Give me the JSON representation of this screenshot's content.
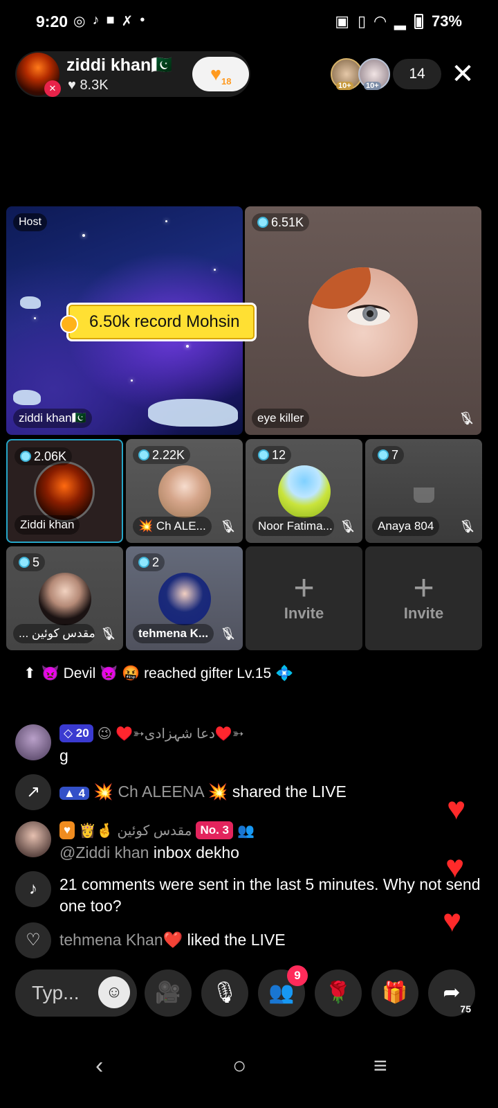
{
  "status": {
    "time": "9:20",
    "battery": "73%"
  },
  "host": {
    "name": "ziddi khan🇵🇰",
    "likes": "8.3K",
    "follow_count": "18"
  },
  "viewers": {
    "badge1": "10+",
    "badge2": "10+",
    "count": "14"
  },
  "stage": {
    "host_label": "Host",
    "host_tile_name": "ziddi khan🇵🇰",
    "record_banner": "6.50k record Mohsin",
    "guest_main": {
      "score": "6.51K",
      "name": "eye killer"
    },
    "guests": [
      {
        "score": "2.06K",
        "name": "Ziddi khan"
      },
      {
        "score": "2.22K",
        "name": "💥 Ch ALE..."
      },
      {
        "score": "12",
        "name": "Noor Fatima..."
      },
      {
        "score": "7",
        "name": "Anaya 804"
      },
      {
        "score": "5",
        "name": "... مقدس کوئین"
      },
      {
        "score": "2",
        "name": "tehmena K..."
      }
    ],
    "invite_label": "Invite"
  },
  "system_msg": "👿 Devil 👿 🤬 reached gifter Lv.15 💠",
  "chat": [
    {
      "badge": "20",
      "user": "😉 ♥️➳دعا شہزادی♥️➳",
      "text": "g"
    },
    {
      "badge": "4",
      "user": "💥 Ch ALEENA 💥",
      "text": "shared the LIVE"
    },
    {
      "user": "👸🤞 مقدس کوئین",
      "rank": "No. 3",
      "mention": "@Ziddi khan",
      "text": "inbox dekho"
    },
    {
      "text": "21 comments were sent in the last 5 minutes. Why not send one too?"
    },
    {
      "user": "tehmena Khan❤️",
      "text": "liked the LIVE"
    }
  ],
  "toolbar": {
    "type_placeholder": "Typ...",
    "notif_count": "9",
    "share_count": "75"
  },
  "icons": [
    "whatsapp-icon",
    "tiktok-icon",
    "video-icon",
    "close-icon",
    "heart-icon",
    "share-icon",
    "mic-icon",
    "gift-icon",
    "rose-icon",
    "people-icon",
    "camera-off-icon"
  ],
  "colors": {
    "accent": "#26a7c9",
    "record_yellow": "#ffe033",
    "heart": "#ff2a2a",
    "notif": "#ff2b5a"
  }
}
